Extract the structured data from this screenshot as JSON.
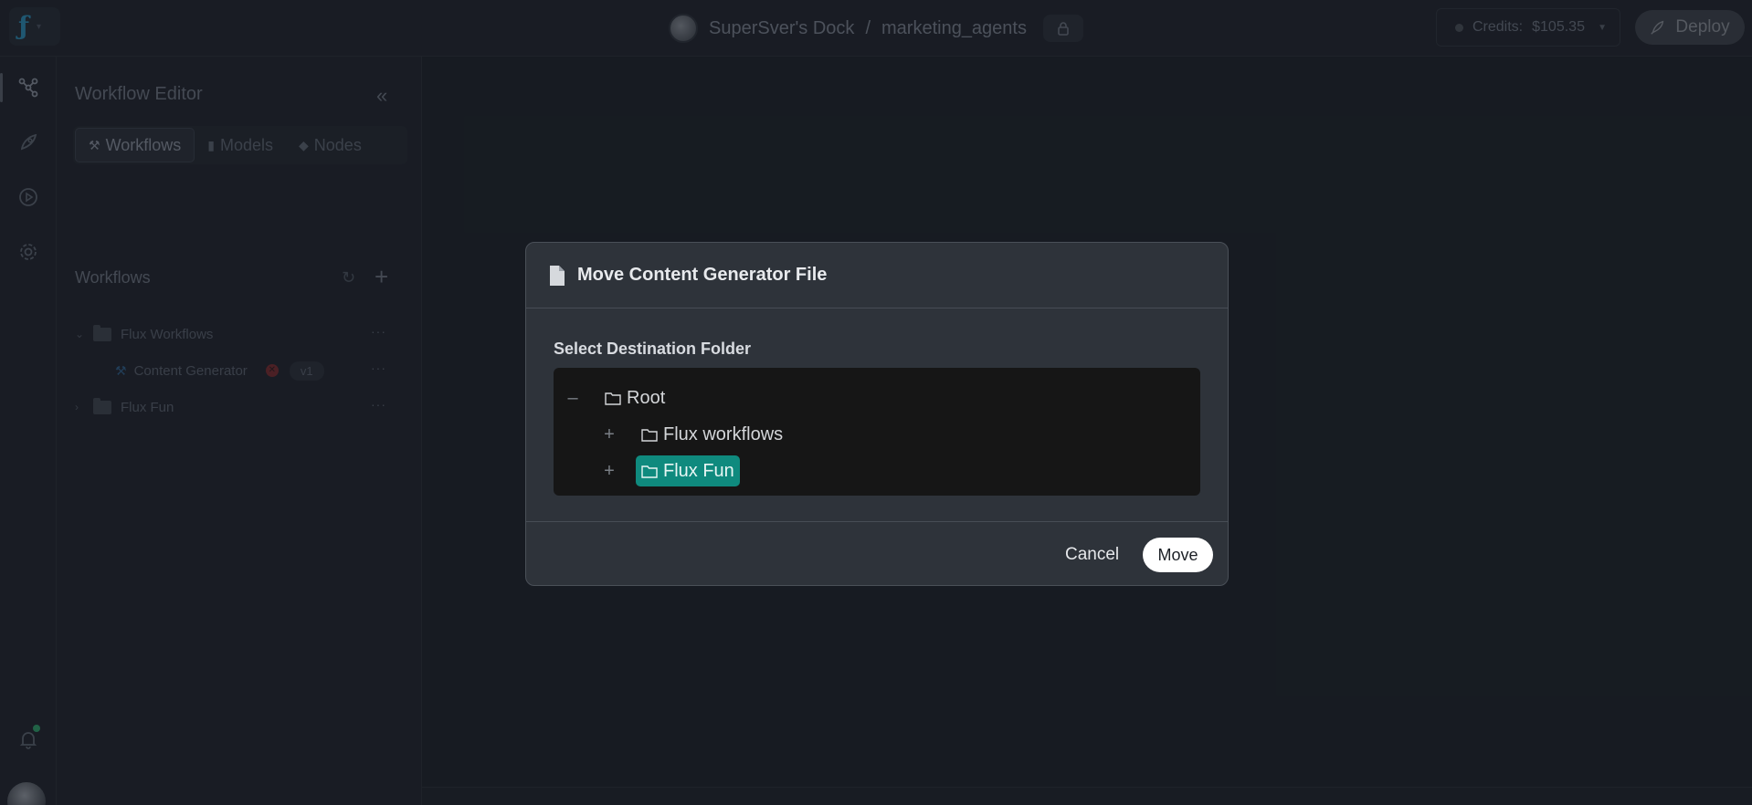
{
  "topbar": {
    "workspace": "SuperSver's Dock",
    "separator": "/",
    "project": "marketing_agents",
    "credits_label": "Credits:",
    "credits_value": "$105.35",
    "deploy_label": "Deploy"
  },
  "rail": {
    "items": [
      "workflow-icon",
      "rocket-icon",
      "play-icon",
      "gear-icon"
    ],
    "bottom": [
      "bell-icon",
      "avatar"
    ]
  },
  "panel": {
    "title": "Workflow Editor",
    "tabs": [
      {
        "label": "Workflows",
        "icon": "workflow-icon",
        "active": true
      },
      {
        "label": "Models",
        "icon": "file-icon",
        "active": false
      },
      {
        "label": "Nodes",
        "icon": "puzzle-icon",
        "active": false
      }
    ],
    "section_title": "Workflows",
    "tree": [
      {
        "label": "Flux Workflows",
        "expanded": true
      },
      {
        "label": "Content Generator",
        "version": "v1",
        "status": "error"
      },
      {
        "label": "Flux Fun",
        "expanded": false
      }
    ]
  },
  "dialog": {
    "title": "Move Content Generator File",
    "destination_label": "Select Destination Folder",
    "tree": [
      {
        "label": "Root",
        "toggle": "–",
        "level": 0,
        "selected": false
      },
      {
        "label": "Flux workflows",
        "toggle": "+",
        "level": 1,
        "selected": false
      },
      {
        "label": "Flux Fun",
        "toggle": "+",
        "level": 1,
        "selected": true
      }
    ],
    "cancel_label": "Cancel",
    "move_label": "Move"
  },
  "colors": {
    "background": "#1c2129",
    "dialog": "#2e333a",
    "tree_box": "#161616",
    "selected_accent": "#0f8a7e",
    "logo": "#2a8fb8",
    "status_green": "#2fa36b"
  }
}
